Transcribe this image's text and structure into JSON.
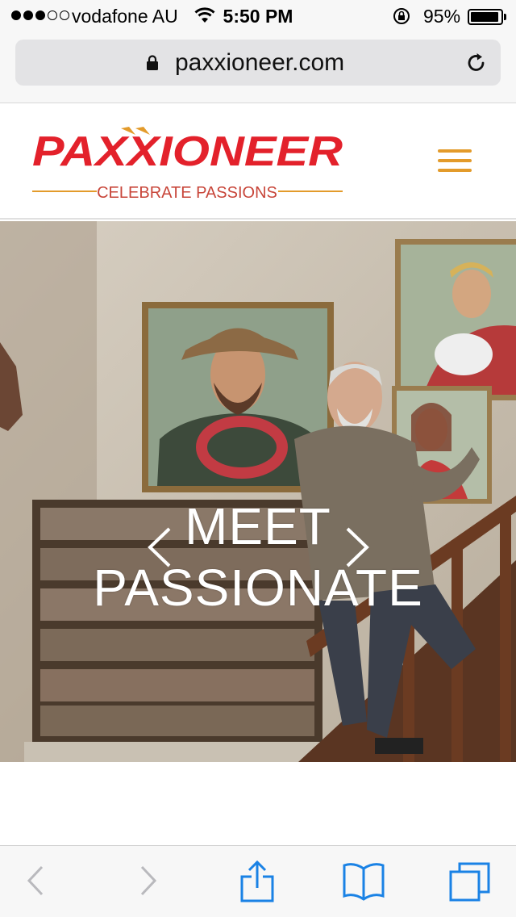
{
  "status_bar": {
    "signal_bars_filled": 3,
    "signal_bars_total": 5,
    "carrier": "vodafone AU",
    "time": "5:50 PM",
    "battery_percent_text": "95%",
    "battery_level": 0.95
  },
  "browser": {
    "url": "paxxioneer.com",
    "icons": {
      "lock": "lock-icon",
      "reload": "reload-icon"
    }
  },
  "site": {
    "logo_text": "PAXXIONEER",
    "tagline": "CELEBRATE PASSIONS",
    "brand_red": "#e3212b",
    "accent_orange": "#e39b2b",
    "menu_icon": "hamburger-icon"
  },
  "hero": {
    "title_line1": "MEET",
    "title_line2": "PASSIONATE",
    "prev_icon": "chevron-left-icon",
    "next_icon": "chevron-right-icon"
  },
  "toolbar": {
    "icons": [
      "back-icon",
      "forward-icon",
      "share-icon",
      "bookmarks-icon",
      "tabs-icon"
    ],
    "tint": "#1a82e5",
    "disabled_tint": "#b9b9bd"
  }
}
